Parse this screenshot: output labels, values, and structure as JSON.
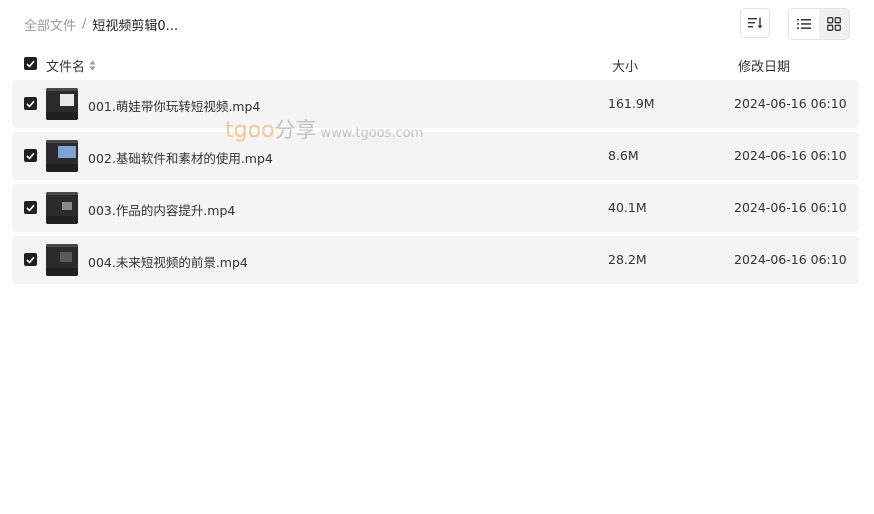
{
  "breadcrumb": {
    "root": "全部文件",
    "separator": "/",
    "current": "短视频剪辑0..."
  },
  "toolbar": {
    "sort_icon": "sort-lines-icon",
    "list_view_icon": "list-view-icon",
    "grid_view_icon": "grid-view-icon",
    "active_view": "list"
  },
  "header": {
    "name": "文件名",
    "size": "大小",
    "date": "修改日期",
    "select_all_checked": true
  },
  "files": [
    {
      "name": "001.萌娃带你玩转短视频.mp4",
      "size": "161.9M",
      "date": "2024-06-16 06:10",
      "checked": true
    },
    {
      "name": "002.基础软件和素材的使用.mp4",
      "size": "8.6M",
      "date": "2024-06-16 06:10",
      "checked": true
    },
    {
      "name": "003.作品的内容提升.mp4",
      "size": "40.1M",
      "date": "2024-06-16 06:10",
      "checked": true
    },
    {
      "name": "004.未来短视频的前景.mp4",
      "size": "28.2M",
      "date": "2024-06-16 06:10",
      "checked": true
    }
  ],
  "watermark": {
    "brand": "tgoo",
    "share": "分享",
    "url": "www.tgoos.com"
  },
  "colors": {
    "checkbox": "#1f1f1f",
    "row_background": "#f4f4f4",
    "watermark_brand": "#f0a64a"
  }
}
